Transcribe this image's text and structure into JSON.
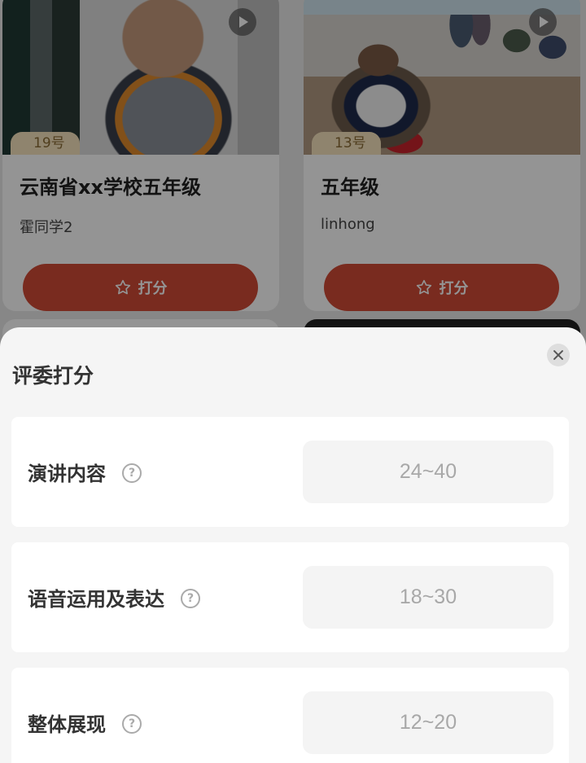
{
  "entries": [
    {
      "number": "19号",
      "title": "云南省xx学校五年级",
      "author": "霍同学2",
      "score_button": "打分"
    },
    {
      "number": "13号",
      "title": "五年级",
      "author": "linhong",
      "score_button": "打分"
    }
  ],
  "sheet": {
    "title": "评委打分",
    "criteria": [
      {
        "label": "演讲内容",
        "placeholder": "24~40"
      },
      {
        "label": "语音运用及表达",
        "placeholder": "18~30"
      },
      {
        "label": "整体展现",
        "placeholder": "12~20"
      }
    ]
  },
  "colors": {
    "score_button": "#d04a36",
    "number_badge": "#f6e4be",
    "sheet_bg": "#f5f5f5"
  },
  "icons": {
    "play": "play-icon",
    "star": "star-icon",
    "help": "help-icon",
    "close": "close-icon"
  }
}
